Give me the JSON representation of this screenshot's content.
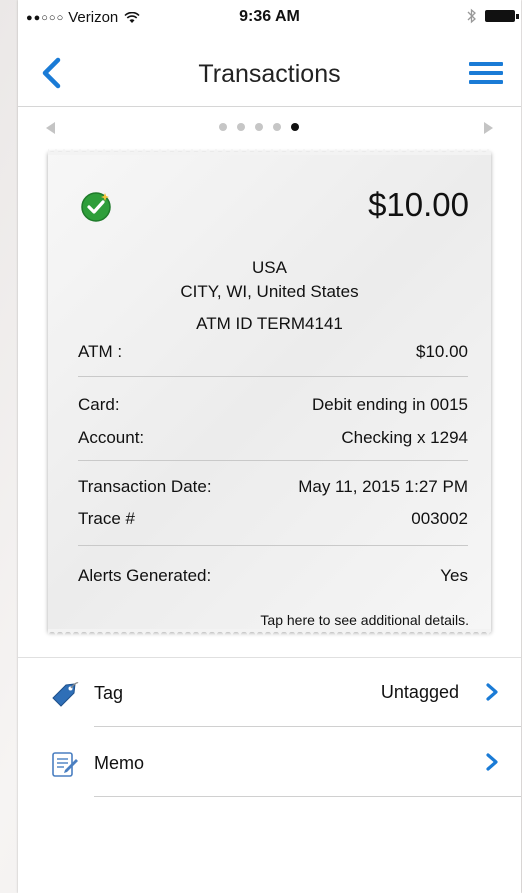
{
  "status_bar": {
    "signal_dots": "●●○○○",
    "carrier": "Verizon",
    "time": "9:36 AM",
    "bluetooth": "∗"
  },
  "nav": {
    "title": "Transactions"
  },
  "pager": {
    "total_pages": 5,
    "active_page": 5
  },
  "receipt": {
    "amount": "$10.00",
    "merchant": {
      "line1": "USA",
      "line2": "CITY, WI, United States",
      "line3": "ATM ID TERM4141"
    },
    "type_label": "ATM :",
    "type_value": "$10.00",
    "card_label": "Card:",
    "card_value": "Debit ending in 0015",
    "account_label": "Account:",
    "account_value": "Checking x 1294",
    "date_label": "Transaction Date:",
    "date_value": "May 11, 2015 1:27 PM",
    "trace_label": "Trace #",
    "trace_value": "003002",
    "alerts_label": "Alerts Generated:",
    "alerts_value": "Yes",
    "details_hint": "Tap here to see additional details."
  },
  "list": {
    "tag_label": "Tag",
    "tag_value": "Untagged",
    "memo_label": "Memo"
  },
  "colors": {
    "accent_blue": "#1a7bd6",
    "check_green": "#2e9e3a"
  }
}
